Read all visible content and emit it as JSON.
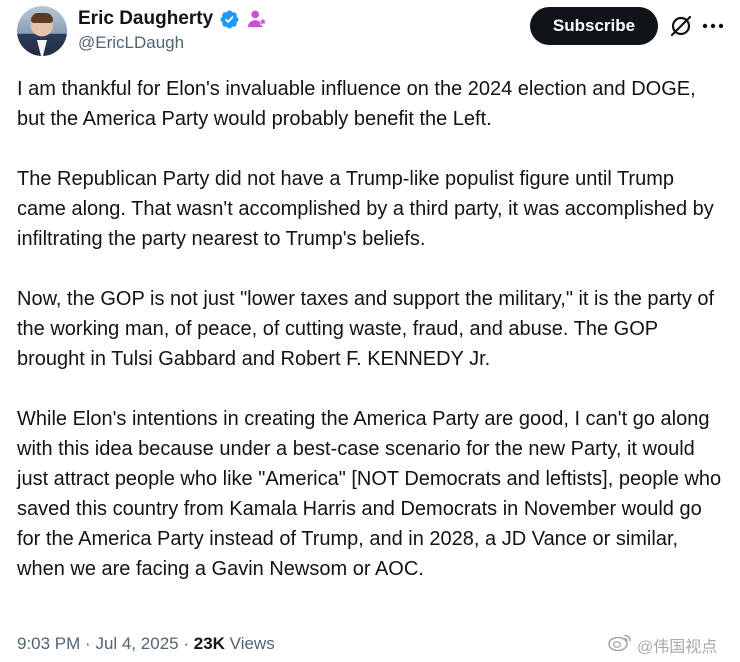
{
  "author": {
    "name": "Eric Daugherty",
    "handle": "@EricLDaugh"
  },
  "actions": {
    "subscribe_label": "Subscribe"
  },
  "icons": {
    "verified": "verified-badge-icon",
    "affiliation": "affiliation-badge-icon",
    "grok": "grok-icon",
    "more": "more-icon",
    "weibo": "weibo-icon"
  },
  "colors": {
    "verified_blue": "#1d9bf0",
    "affiliation_purple": "#c94fd6",
    "subscribe_bg": "#0f1419"
  },
  "tweet": {
    "paragraphs": [
      "I am thankful for Elon's invaluable influence on the 2024 election and DOGE, but the America Party would probably benefit the Left.",
      "The Republican Party did not have a Trump-like populist figure until Trump came along. That wasn't accomplished by a third party, it was accomplished by infiltrating the party nearest to Trump's beliefs.",
      "Now, the GOP is not just \"lower taxes and support the military,\" it is the party of the working man, of peace, of cutting waste, fraud, and abuse. The GOP brought in Tulsi Gabbard and Robert F. KENNEDY Jr.",
      "While Elon's intentions in creating the America Party are good, I can't go along with this idea because under a best-case scenario for the new Party, it would just attract people who like \"America\" [NOT Democrats and leftists], people who saved this country from Kamala Harris and Democrats in November would go for the America Party instead of Trump, and in 2028, a JD Vance or similar, when we are facing a Gavin Newsom or AOC."
    ],
    "time": "9:03 PM",
    "date": "Jul 4, 2025",
    "views_count": "23K",
    "views_label": "Views"
  },
  "watermark": {
    "text": "@伟国视点"
  }
}
